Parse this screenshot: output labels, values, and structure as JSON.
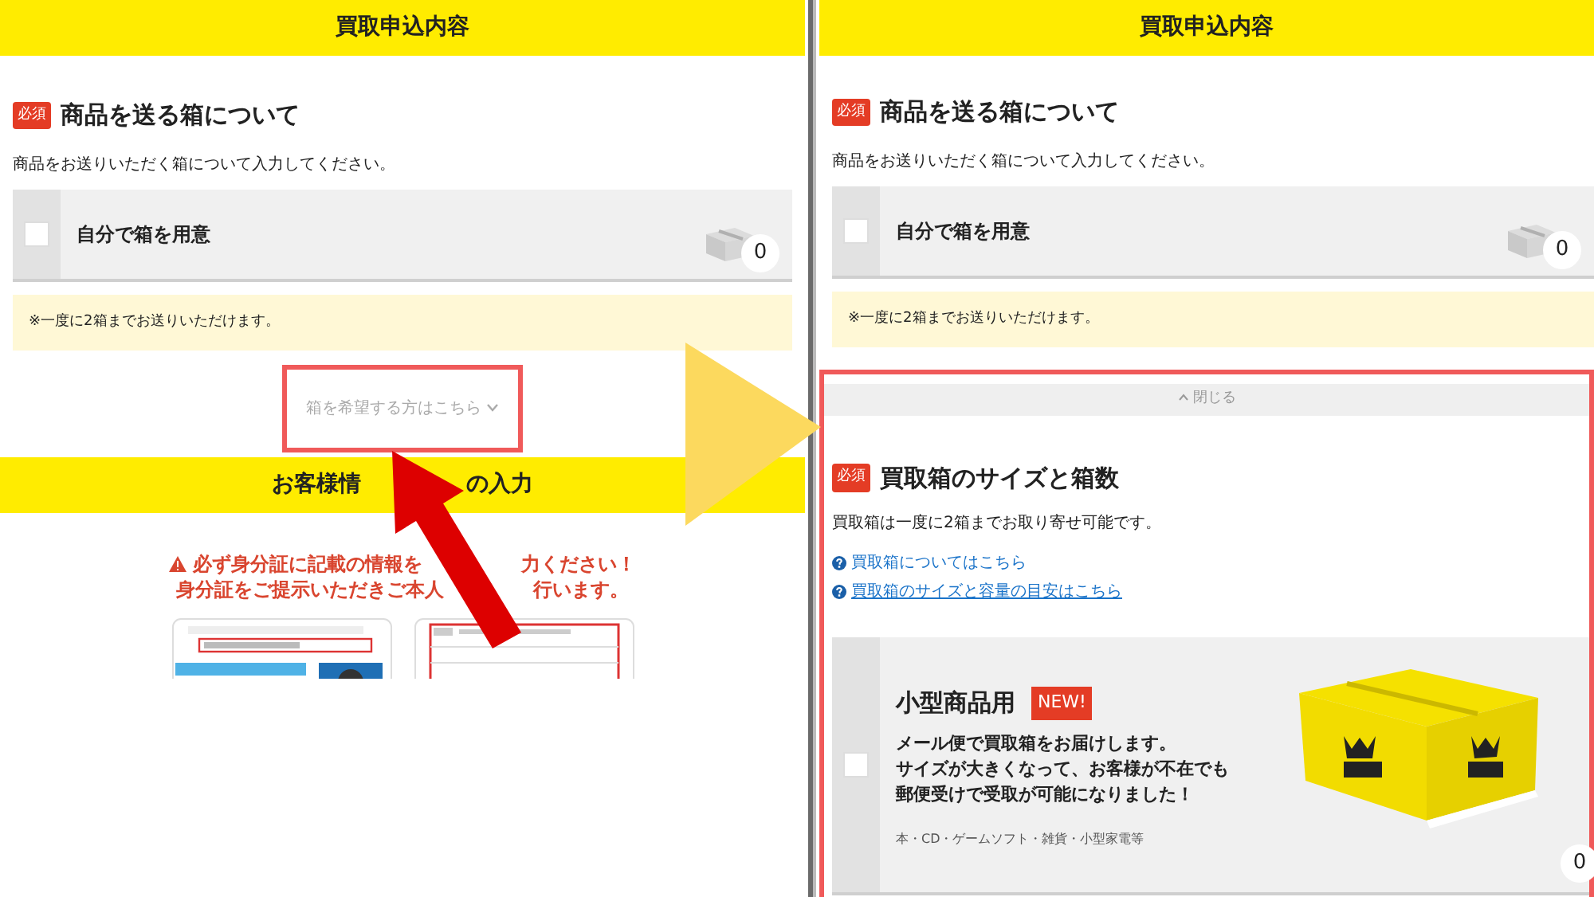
{
  "left": {
    "header": "買取申込内容",
    "section": {
      "badge": "必須",
      "title": "商品を送る箱について",
      "description": "商品をお送りいただく箱について入力してください。",
      "option": {
        "label": "自分で箱を用意",
        "checked": false,
        "count": "0"
      },
      "note": "※一度に2箱までお送りいただけます。"
    },
    "expand_link": {
      "label": "箱を希望する方はこちら",
      "highlighted": true
    },
    "customer_header_parts": [
      "お客様情",
      "の入力"
    ],
    "warning_lines": [
      [
        "必ず身分証に記載の情報を",
        "力ください！"
      ],
      [
        "身分証をご提示いただきご本人",
        "行います。"
      ]
    ]
  },
  "right": {
    "header": "買取申込内容",
    "section": {
      "badge": "必須",
      "title": "商品を送る箱について",
      "description": "商品をお送りいただく箱について入力してください。",
      "option": {
        "label": "自分で箱を用意",
        "checked": false,
        "count": "0"
      },
      "note": "※一度に2箱までお送りいただけます。"
    },
    "expanded_panel": {
      "highlighted": true,
      "collapse_label": "閉じる",
      "badge": "必須",
      "title": "買取箱のサイズと箱数",
      "description": "買取箱は一度に2箱までお取り寄せ可能です。",
      "links": [
        {
          "label": "買取箱についてはこちら",
          "underlined": false
        },
        {
          "label": "買取箱のサイズと容量の目安はこちら",
          "underlined": true
        }
      ],
      "products": [
        {
          "label": "小型商品用",
          "badge": "NEW!",
          "checked": false,
          "description_lines": [
            "メール便で買取箱をお届けします。",
            "サイズが大きくなって、お客様が不在でも",
            "郵便受けで受取が可能になりました！"
          ],
          "categories": "本・CD・ゲームソフト・雑貨・小型家電等",
          "count": "0"
        }
      ]
    }
  }
}
